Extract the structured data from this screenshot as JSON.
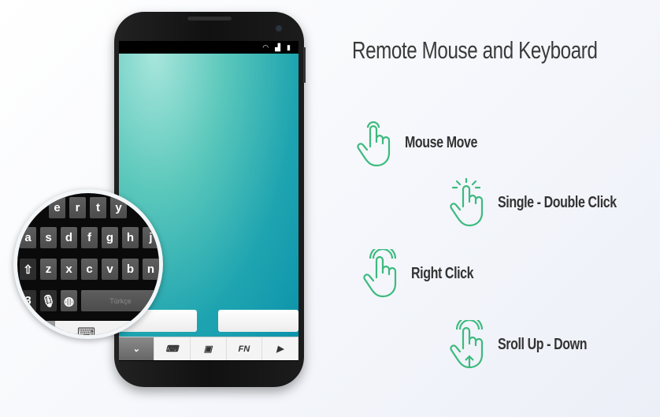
{
  "title": "Remote Mouse and Keyboard",
  "accent": "#3dba7e",
  "features": [
    {
      "label": "Mouse Move",
      "icon": "hand-pointer-icon"
    },
    {
      "label": "Single - Double Click",
      "icon": "hand-tap-icon"
    },
    {
      "label": "Right Click",
      "icon": "hand-two-finger-icon"
    },
    {
      "label": "Sroll  Up - Down",
      "icon": "hand-scroll-icon"
    }
  ],
  "toolbar": {
    "fn_label": "FN"
  },
  "keyboard": {
    "row1": [
      "e",
      "r",
      "t",
      "y"
    ],
    "row2": [
      "a",
      "s",
      "d",
      "f",
      "g",
      "h",
      "j"
    ],
    "row3": [
      "z",
      "x",
      "c",
      "v",
      "b",
      "n"
    ],
    "sym": "3",
    "space": "Türkçe"
  }
}
